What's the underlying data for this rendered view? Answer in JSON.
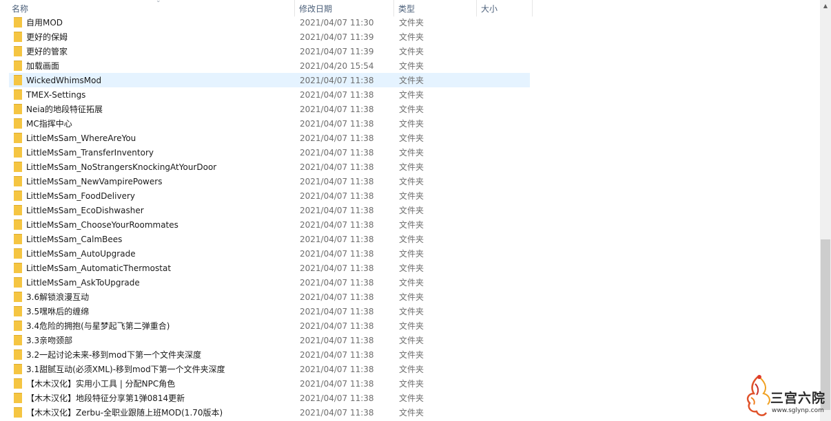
{
  "columns": {
    "name": "名称",
    "date": "修改日期",
    "type": "类型",
    "size": "大小"
  },
  "sort_indicator": "⌄",
  "colors": {
    "folder": "#f5c542",
    "folder_shade": "#dcaa2b",
    "selected_row": "#e5f3ff",
    "header_text": "#4c607a",
    "secondary_text": "#6d6d6d",
    "scroll_thumb": "#cdcdcd"
  },
  "files": [
    {
      "name": "自用MOD",
      "date": "2021/04/07 11:30",
      "type": "文件夹",
      "selected": false
    },
    {
      "name": "更好的保姆",
      "date": "2021/04/07 11:39",
      "type": "文件夹",
      "selected": false
    },
    {
      "name": "更好的管家",
      "date": "2021/04/07 11:39",
      "type": "文件夹",
      "selected": false
    },
    {
      "name": "加载画面",
      "date": "2021/04/20 15:54",
      "type": "文件夹",
      "selected": false
    },
    {
      "name": "WickedWhimsMod",
      "date": "2021/04/07 11:38",
      "type": "文件夹",
      "selected": true
    },
    {
      "name": "TMEX-Settings",
      "date": "2021/04/07 11:38",
      "type": "文件夹",
      "selected": false
    },
    {
      "name": "Neia的地段特征拓展",
      "date": "2021/04/07 11:38",
      "type": "文件夹",
      "selected": false
    },
    {
      "name": "MC指挥中心",
      "date": "2021/04/07 11:38",
      "type": "文件夹",
      "selected": false
    },
    {
      "name": "LittleMsSam_WhereAreYou",
      "date": "2021/04/07 11:38",
      "type": "文件夹",
      "selected": false
    },
    {
      "name": "LittleMsSam_TransferInventory",
      "date": "2021/04/07 11:38",
      "type": "文件夹",
      "selected": false
    },
    {
      "name": "LittleMsSam_NoStrangersKnockingAtYourDoor",
      "date": "2021/04/07 11:38",
      "type": "文件夹",
      "selected": false
    },
    {
      "name": "LittleMsSam_NewVampirePowers",
      "date": "2021/04/07 11:38",
      "type": "文件夹",
      "selected": false
    },
    {
      "name": "LittleMsSam_FoodDelivery",
      "date": "2021/04/07 11:38",
      "type": "文件夹",
      "selected": false
    },
    {
      "name": "LittleMsSam_EcoDishwasher",
      "date": "2021/04/07 11:38",
      "type": "文件夹",
      "selected": false
    },
    {
      "name": "LittleMsSam_ChooseYourRoommates",
      "date": "2021/04/07 11:38",
      "type": "文件夹",
      "selected": false
    },
    {
      "name": "LittleMsSam_CalmBees",
      "date": "2021/04/07 11:38",
      "type": "文件夹",
      "selected": false
    },
    {
      "name": "LittleMsSam_AutoUpgrade",
      "date": "2021/04/07 11:38",
      "type": "文件夹",
      "selected": false
    },
    {
      "name": "LittleMsSam_AutomaticThermostat",
      "date": "2021/04/07 11:38",
      "type": "文件夹",
      "selected": false
    },
    {
      "name": "LittleMsSam_AskToUpgrade",
      "date": "2021/04/07 11:38",
      "type": "文件夹",
      "selected": false
    },
    {
      "name": "3.6解锁浪漫互动",
      "date": "2021/04/07 11:38",
      "type": "文件夹",
      "selected": false
    },
    {
      "name": "3.5嘿咻后的缠绵",
      "date": "2021/04/07 11:38",
      "type": "文件夹",
      "selected": false
    },
    {
      "name": "3.4危险的拥抱(与星梦起飞第二弹重合)",
      "date": "2021/04/07 11:38",
      "type": "文件夹",
      "selected": false
    },
    {
      "name": "3.3亲吻颈部",
      "date": "2021/04/07 11:38",
      "type": "文件夹",
      "selected": false
    },
    {
      "name": "3.2一起讨论未来-移到mod下第一个文件夹深度",
      "date": "2021/04/07 11:38",
      "type": "文件夹",
      "selected": false
    },
    {
      "name": "3.1甜腻互动(必须XML)-移到mod下第一个文件夹深度",
      "date": "2021/04/07 11:38",
      "type": "文件夹",
      "selected": false
    },
    {
      "name": "【木木汉化】实用小工具 | 分配NPC角色",
      "date": "2021/04/07 11:38",
      "type": "文件夹",
      "selected": false
    },
    {
      "name": "【木木汉化】地段特征分享第1弹0814更新",
      "date": "2021/04/07 11:38",
      "type": "文件夹",
      "selected": false
    },
    {
      "name": "【木木汉化】Zerbu-全职业跟随上班MOD(1.70版本)",
      "date": "2021/04/07 11:38",
      "type": "文件夹",
      "selected": false
    }
  ],
  "scrollbar": {
    "up_glyph": "▲"
  },
  "watermark": {
    "logo_text": "三宫六院",
    "url": "www.sglynp.com"
  }
}
